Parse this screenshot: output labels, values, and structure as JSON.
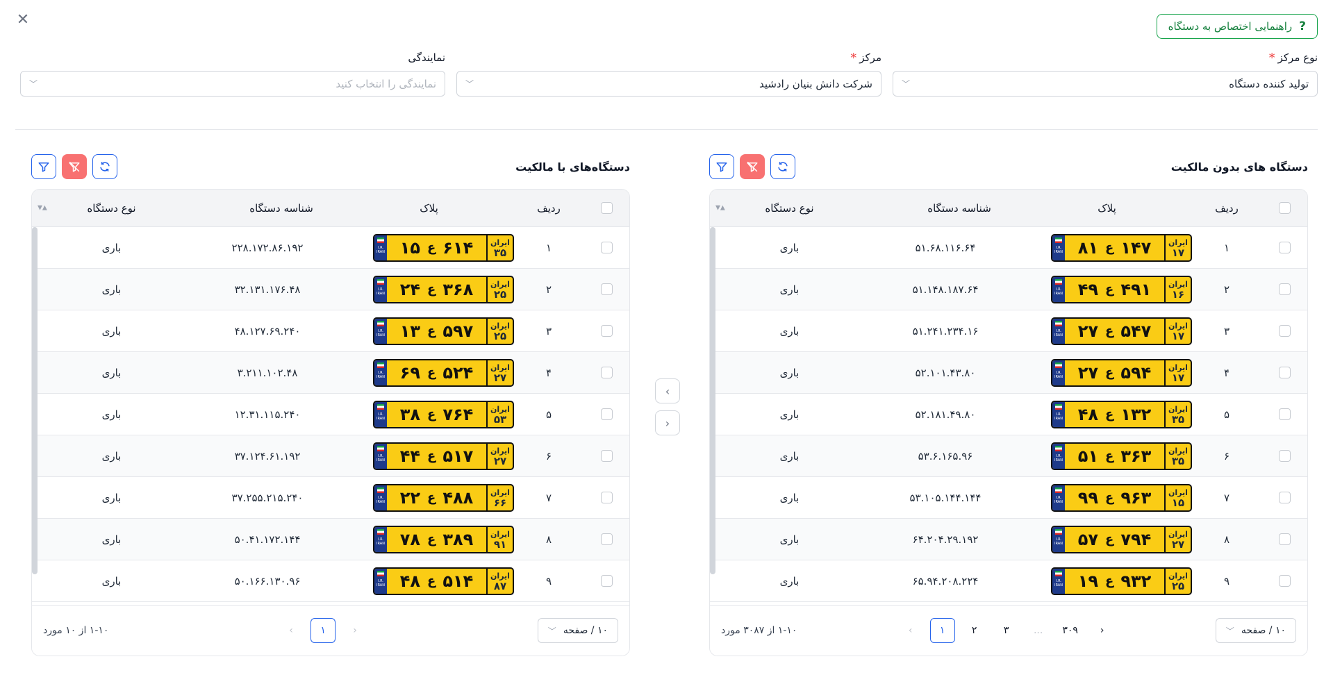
{
  "guide": {
    "label": "راهنمایی اختصاص به دستگاه",
    "icon": "?"
  },
  "close_icon": "✕",
  "fields": [
    {
      "label": "نوع مرکز",
      "required": true,
      "value": "تولید کننده دستگاه"
    },
    {
      "label": "مرکز",
      "required": true,
      "value": "شرکت دانش بنیان رادشید"
    },
    {
      "label": "نمایندگی",
      "required": false,
      "placeholder": "نمایندگی را انتخاب کنید"
    }
  ],
  "columns": {
    "row": "ردیف",
    "plate": "پلاک",
    "id": "شناسه دستگاه",
    "type": "نوع دستگاه"
  },
  "plate_country": "ایران",
  "plate_flag_text": "I.R. IRAN",
  "right_panel": {
    "title": "دستگاه های بدون مالکیت",
    "rows": [
      {
        "idx": "۱",
        "plate": {
          "left": "۸۱",
          "letter": "ع",
          "mid": "۱۴۷",
          "region": "۱۷"
        },
        "id": "۵۱.۶۸.۱۱۶.۶۴",
        "type": "باری"
      },
      {
        "idx": "۲",
        "plate": {
          "left": "۴۹",
          "letter": "ع",
          "mid": "۴۹۱",
          "region": "۱۶"
        },
        "id": "۵۱.۱۴۸.۱۸۷.۶۴",
        "type": "باری"
      },
      {
        "idx": "۳",
        "plate": {
          "left": "۲۷",
          "letter": "ع",
          "mid": "۵۴۷",
          "region": "۱۷"
        },
        "id": "۵۱.۲۴۱.۲۳۴.۱۶",
        "type": "باری"
      },
      {
        "idx": "۴",
        "plate": {
          "left": "۲۷",
          "letter": "ع",
          "mid": "۵۹۴",
          "region": "۱۷"
        },
        "id": "۵۲.۱۰۱.۴۳.۸۰",
        "type": "باری"
      },
      {
        "idx": "۵",
        "plate": {
          "left": "۴۸",
          "letter": "ع",
          "mid": "۱۳۲",
          "region": "۳۵"
        },
        "id": "۵۲.۱۸۱.۴۹.۸۰",
        "type": "باری"
      },
      {
        "idx": "۶",
        "plate": {
          "left": "۵۱",
          "letter": "ع",
          "mid": "۳۶۳",
          "region": "۳۵"
        },
        "id": "۵۳.۶.۱۶۵.۹۶",
        "type": "باری"
      },
      {
        "idx": "۷",
        "plate": {
          "left": "۹۹",
          "letter": "ع",
          "mid": "۹۶۳",
          "region": "۱۵"
        },
        "id": "۵۳.۱۰۵.۱۴۴.۱۴۴",
        "type": "باری"
      },
      {
        "idx": "۸",
        "plate": {
          "left": "۵۷",
          "letter": "ع",
          "mid": "۷۹۴",
          "region": "۲۷"
        },
        "id": "۶۴.۲۰۴.۲۹.۱۹۲",
        "type": "باری"
      },
      {
        "idx": "۹",
        "plate": {
          "left": "۱۹",
          "letter": "ع",
          "mid": "۹۳۲",
          "region": "۲۵"
        },
        "id": "۶۵.۹۴.۲۰۸.۲۲۴",
        "type": "باری"
      }
    ],
    "page_size": "۱۰ / صفحه",
    "pages": [
      "۱",
      "۲",
      "۳",
      "...",
      "۳۰۹"
    ],
    "total": "۱-۱۰ از ۳۰۸۷ مورد"
  },
  "left_panel": {
    "title": "دستگاه‌های با مالکیت",
    "rows": [
      {
        "idx": "۱",
        "plate": {
          "left": "۱۵",
          "letter": "ع",
          "mid": "۶۱۴",
          "region": "۳۵"
        },
        "id": "۲۲۸.۱۷۲.۸۶.۱۹۲",
        "type": "باری"
      },
      {
        "idx": "۲",
        "plate": {
          "left": "۲۴",
          "letter": "ع",
          "mid": "۳۶۸",
          "region": "۲۵"
        },
        "id": "۳۲.۱۳۱.۱۷۶.۴۸",
        "type": "باری"
      },
      {
        "idx": "۳",
        "plate": {
          "left": "۱۳",
          "letter": "ع",
          "mid": "۵۹۷",
          "region": "۲۵"
        },
        "id": "۴۸.۱۲۷.۶۹.۲۴۰",
        "type": "باری"
      },
      {
        "idx": "۴",
        "plate": {
          "left": "۶۹",
          "letter": "ع",
          "mid": "۵۲۴",
          "region": "۲۷"
        },
        "id": "۳.۲۱۱.۱۰۲.۴۸",
        "type": "باری"
      },
      {
        "idx": "۵",
        "plate": {
          "left": "۳۸",
          "letter": "ع",
          "mid": "۷۶۴",
          "region": "۵۳"
        },
        "id": "۱۲.۳۱.۱۱۵.۲۴۰",
        "type": "باری"
      },
      {
        "idx": "۶",
        "plate": {
          "left": "۴۴",
          "letter": "ع",
          "mid": "۵۱۷",
          "region": "۲۷"
        },
        "id": "۳۷.۱۲۴.۶۱.۱۹۲",
        "type": "باری"
      },
      {
        "idx": "۷",
        "plate": {
          "left": "۲۲",
          "letter": "ع",
          "mid": "۴۸۸",
          "region": "۶۶"
        },
        "id": "۳۷.۲۵۵.۲۱۵.۲۴۰",
        "type": "باری"
      },
      {
        "idx": "۸",
        "plate": {
          "left": "۷۸",
          "letter": "ع",
          "mid": "۳۸۹",
          "region": "۹۱"
        },
        "id": "۵۰.۴۱.۱۷۲.۱۴۴",
        "type": "باری"
      },
      {
        "idx": "۹",
        "plate": {
          "left": "۴۸",
          "letter": "ع",
          "mid": "۵۱۴",
          "region": "۸۷"
        },
        "id": "۵۰.۱۶۶.۱۳۰.۹۶",
        "type": "باری"
      }
    ],
    "page_size": "۱۰ / صفحه",
    "pages": [
      "۱"
    ],
    "total": "۱-۱۰ از ۱۰ مورد"
  },
  "colors": {
    "accent": "#2563eb",
    "guide": "#16a34a",
    "plate": "#facc15",
    "danger": "#f87171"
  }
}
